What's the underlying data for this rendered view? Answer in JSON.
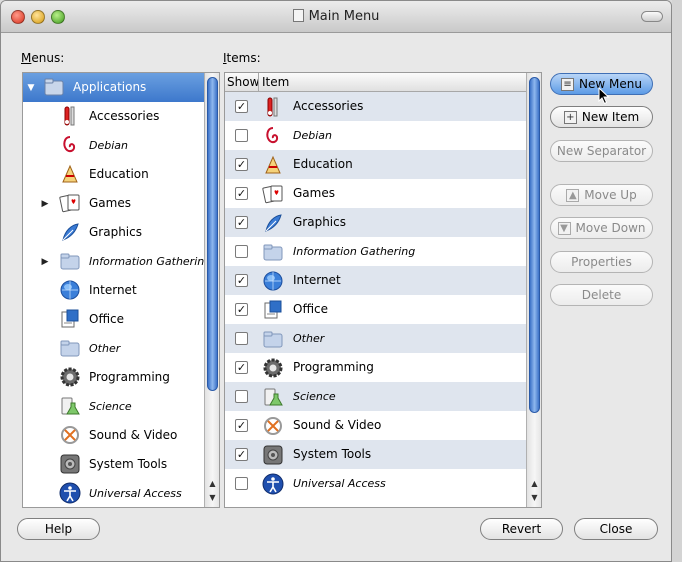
{
  "window": {
    "title": "Main Menu"
  },
  "labels": {
    "menus": "Menus:",
    "items": "Items:",
    "menus_mnemonic": "M",
    "menus_rest": "enus:",
    "items_mnemonic": "I",
    "items_rest": "tems:"
  },
  "menus": [
    {
      "label": "Applications",
      "expander": "▼",
      "icon": "applications-folder-icon",
      "italic": false,
      "selected": true,
      "indent": 0
    },
    {
      "label": "Accessories",
      "expander": "",
      "icon": "accessories-icon",
      "italic": false,
      "selected": false,
      "indent": 1
    },
    {
      "label": "Debian",
      "expander": "",
      "icon": "debian-swirl-icon",
      "italic": true,
      "selected": false,
      "indent": 1
    },
    {
      "label": "Education",
      "expander": "",
      "icon": "education-icon",
      "italic": false,
      "selected": false,
      "indent": 1
    },
    {
      "label": "Games",
      "expander": "▶",
      "icon": "games-cards-icon",
      "italic": false,
      "selected": false,
      "indent": 1
    },
    {
      "label": "Graphics",
      "expander": "",
      "icon": "graphics-quill-icon",
      "italic": false,
      "selected": false,
      "indent": 1
    },
    {
      "label": "Information Gathering",
      "expander": "▶",
      "icon": "folder-icon",
      "italic": true,
      "selected": false,
      "indent": 1
    },
    {
      "label": "Internet",
      "expander": "",
      "icon": "internet-globe-icon",
      "italic": false,
      "selected": false,
      "indent": 1
    },
    {
      "label": "Office",
      "expander": "",
      "icon": "office-icon",
      "italic": false,
      "selected": false,
      "indent": 1
    },
    {
      "label": "Other",
      "expander": "",
      "icon": "folder-icon",
      "italic": true,
      "selected": false,
      "indent": 1
    },
    {
      "label": "Programming",
      "expander": "",
      "icon": "programming-gear-icon",
      "italic": false,
      "selected": false,
      "indent": 1
    },
    {
      "label": "Science",
      "expander": "",
      "icon": "science-flask-icon",
      "italic": true,
      "selected": false,
      "indent": 1
    },
    {
      "label": "Sound & Video",
      "expander": "",
      "icon": "sound-video-icon",
      "italic": false,
      "selected": false,
      "indent": 1
    },
    {
      "label": "System Tools",
      "expander": "",
      "icon": "system-tools-icon",
      "italic": false,
      "selected": false,
      "indent": 1
    },
    {
      "label": "Universal Access",
      "expander": "",
      "icon": "universal-access-icon",
      "italic": true,
      "selected": false,
      "indent": 1
    }
  ],
  "items_table": {
    "headers": {
      "show": "Show",
      "item": "Item"
    },
    "rows": [
      {
        "label": "Accessories",
        "checked": true,
        "icon": "accessories-icon",
        "italic": false
      },
      {
        "label": "Debian",
        "checked": false,
        "icon": "debian-swirl-icon",
        "italic": true
      },
      {
        "label": "Education",
        "checked": true,
        "icon": "education-icon",
        "italic": false
      },
      {
        "label": "Games",
        "checked": true,
        "icon": "games-cards-icon",
        "italic": false
      },
      {
        "label": "Graphics",
        "checked": true,
        "icon": "graphics-quill-icon",
        "italic": false
      },
      {
        "label": "Information Gathering",
        "checked": false,
        "icon": "folder-icon",
        "italic": true
      },
      {
        "label": "Internet",
        "checked": true,
        "icon": "internet-globe-icon",
        "italic": false
      },
      {
        "label": "Office",
        "checked": true,
        "icon": "office-icon",
        "italic": false
      },
      {
        "label": "Other",
        "checked": false,
        "icon": "folder-icon",
        "italic": true
      },
      {
        "label": "Programming",
        "checked": true,
        "icon": "programming-gear-icon",
        "italic": false
      },
      {
        "label": "Science",
        "checked": false,
        "icon": "science-flask-icon",
        "italic": true
      },
      {
        "label": "Sound & Video",
        "checked": true,
        "icon": "sound-video-icon",
        "italic": false
      },
      {
        "label": "System Tools",
        "checked": true,
        "icon": "system-tools-icon",
        "italic": false
      },
      {
        "label": "Universal Access",
        "checked": false,
        "icon": "universal-access-icon",
        "italic": true
      }
    ],
    "check_mark": "✓"
  },
  "buttons": {
    "new_menu": "New Menu",
    "new_item": "New Item",
    "new_separator": "New Separator",
    "move_up": "Move Up",
    "move_down": "Move Down",
    "properties": "Properties",
    "delete": "Delete",
    "help": "Help",
    "revert": "Revert",
    "close": "Close"
  },
  "colors": {
    "selection": "#3d78cc",
    "scroll_thumb": "#3c72c8",
    "alt_row": "#dfe5ee"
  }
}
